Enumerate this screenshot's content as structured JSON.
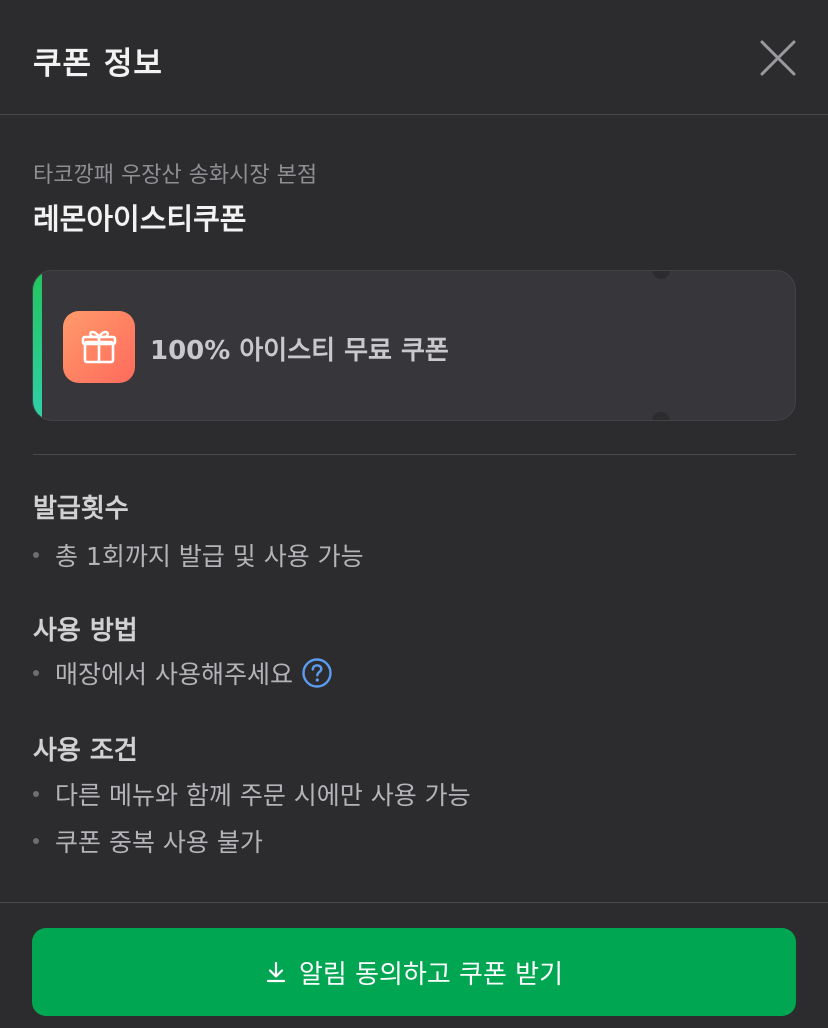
{
  "header": {
    "title": "쿠폰 정보",
    "close_icon": "close-icon"
  },
  "store": {
    "name": "타코깡패 우장산 송화시장 본점"
  },
  "coupon": {
    "name": "레몬아이스티쿠폰",
    "benefit": "100% 아이스티 무료 쿠폰",
    "badge_icon": "gift-icon",
    "stripe_color": "#22c55e"
  },
  "sections": {
    "issue": {
      "title": "발급횟수",
      "items": [
        "총 1회까지 발급 및 사용 가능"
      ]
    },
    "usage": {
      "title": "사용 방법",
      "items": [
        "매장에서 사용해주세요"
      ],
      "help_icon": "question-circle-icon"
    },
    "conditions": {
      "title": "사용 조건",
      "items": [
        "다른 메뉴와 함께 주문 시에만 사용 가능",
        "쿠폰 중복 사용 불가"
      ]
    }
  },
  "cta": {
    "label": "알림 동의하고 쿠폰 받기",
    "icon": "download-icon",
    "color": "#00a651"
  }
}
